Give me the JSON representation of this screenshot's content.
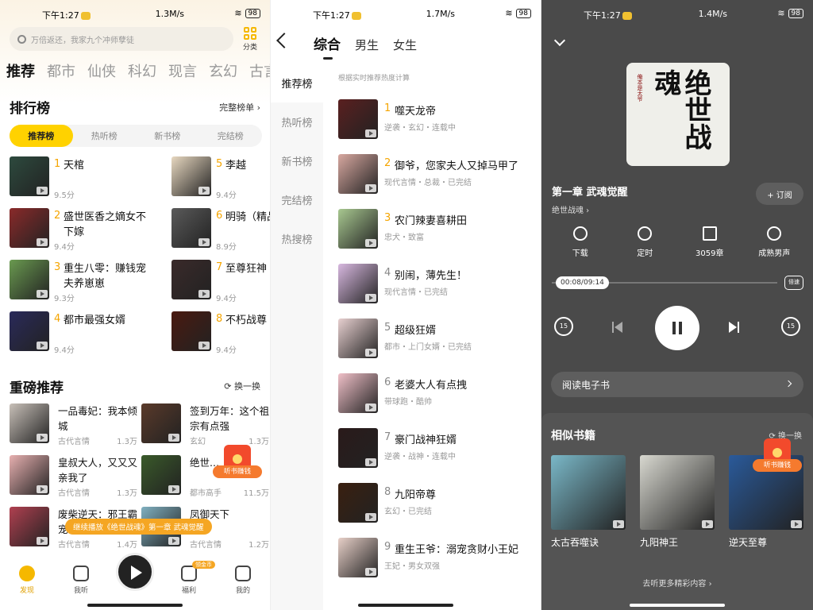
{
  "status": {
    "s1": {
      "time": "下午1:27",
      "speed": "1.3M/s",
      "battery": "98"
    },
    "s2": {
      "time": "下午1:27",
      "speed": "1.7M/s",
      "battery": "98"
    },
    "s3": {
      "time": "下午1:27",
      "speed": "1.4M/s",
      "battery": "98"
    }
  },
  "home": {
    "search_placeholder": "万倍返还，我家九个冲师孽徒",
    "category_label": "分类",
    "tabs": [
      "推荐",
      "都市",
      "仙侠",
      "科幻",
      "现言",
      "玄幻",
      "古言"
    ],
    "rank_title": "排行榜",
    "rank_more": "完整榜单 ›",
    "rank_tabs": [
      "推荐榜",
      "热听榜",
      "新书榜",
      "完结榜"
    ],
    "ranks": [
      {
        "rank": "1",
        "name": "天棺",
        "score": "9.5分",
        "color": "#2d4a3e"
      },
      {
        "rank": "2",
        "name": "盛世医香之嫡女不下嫁",
        "score": "9.4分",
        "color": "#8a2a2a"
      },
      {
        "rank": "3",
        "name": "重生八零：赚钱宠夫养崽崽",
        "score": "9.3分",
        "color": "#6a9a50"
      },
      {
        "rank": "4",
        "name": "都市最强女婿",
        "score": "9.4分",
        "color": "#2a2a5a"
      },
      {
        "rank": "5",
        "name": "李越",
        "score": "9.4分",
        "color": "#e8d8c0"
      },
      {
        "rank": "6",
        "name": "明骑（精品）",
        "score": "8.9分",
        "color": "#5a5a5a"
      },
      {
        "rank": "7",
        "name": "至尊狂神",
        "score": "9.4分",
        "color": "#3a2a2a"
      },
      {
        "rank": "8",
        "name": "不朽战尊",
        "score": "9.4分",
        "color": "#4a1a10"
      }
    ],
    "rec_title": "重磅推荐",
    "rec_more": "换一换",
    "recs": [
      {
        "name": "一品毒妃：我本倾城",
        "genre": "古代言情",
        "plays": "1.3万",
        "color": "#c8c0b8"
      },
      {
        "name": "皇叔大人，又又又亲我了",
        "genre": "古代言情",
        "plays": "1.3万",
        "color": "#e8b0b0"
      },
      {
        "name": "废柴逆天：邪王霸宠",
        "genre": "古代言情",
        "plays": "1.4万",
        "color": "#b04050"
      },
      {
        "name": "签到万年：这个祖宗有点强",
        "genre": "玄幻",
        "plays": "1.3万",
        "color": "#5a3a2a"
      },
      {
        "name": "绝世...",
        "genre": "都市高手",
        "plays": "11.5万",
        "color": "#3a5a2a"
      },
      {
        "name": "凤御天下",
        "genre": "古代言情",
        "plays": "1.2万",
        "color": "#80b0c0"
      }
    ],
    "toast": "继续播放《绝世战魂》第一章 武魂觉醒",
    "redpack_label": "听书赚钱",
    "nav": [
      {
        "label": "发现"
      },
      {
        "label": "我听"
      },
      {
        "label": ""
      },
      {
        "label": "福利",
        "badge": "领金币"
      },
      {
        "label": "我的"
      }
    ]
  },
  "ranking": {
    "tabs": [
      "综合",
      "男生",
      "女生"
    ],
    "side": [
      "推荐榜",
      "热听榜",
      "新书榜",
      "完结榜",
      "热搜榜"
    ],
    "hint": "根据实时推荐热度计算",
    "items": [
      {
        "rank": "1",
        "name": "噬天龙帝",
        "meta": "逆袭・玄幻・连载中",
        "color": "#5a2020"
      },
      {
        "rank": "2",
        "name": "御爷，您家夫人又掉马甲了",
        "meta": "现代言情・总裁・已完结",
        "color": "#d8a8a0"
      },
      {
        "rank": "3",
        "name": "农门辣妻喜耕田",
        "meta": "忠犬・致富",
        "color": "#a8c890"
      },
      {
        "rank": "4",
        "name": "别闹，薄先生！",
        "meta": "现代言情・已完结",
        "color": "#d8b8e0"
      },
      {
        "rank": "5",
        "name": "超级狂婿",
        "meta": "都市・上门女婿・已完结",
        "color": "#e8d0d0"
      },
      {
        "rank": "6",
        "name": "老婆大人有点拽",
        "meta": "带球跑・酷帅",
        "color": "#f0c0c8"
      },
      {
        "rank": "7",
        "name": "豪门战神狂婿",
        "meta": "逆袭・战神・连载中",
        "color": "#2a1a1a"
      },
      {
        "rank": "8",
        "name": "九阳帝尊",
        "meta": "玄幻・已完结",
        "color": "#3a2010"
      },
      {
        "rank": "9",
        "name": "重生王爷：溺宠贪财小王妃",
        "meta": "王妃・男女双强",
        "color": "#e8d0c8"
      }
    ]
  },
  "player": {
    "cover_title": "绝世战魂",
    "cover_sub": "俺本是太爷",
    "chapter": "第一章 武魂觉醒",
    "book": "绝世战魂 ›",
    "subscribe": "+ 订阅",
    "actions": [
      "下载",
      "定时",
      "3059章",
      "成熟男声"
    ],
    "progress_text": "00:08/09:14",
    "progress": 0.015,
    "speed": "1.0x",
    "speed_label": "倍速",
    "skip_back": "15",
    "skip_fwd": "15",
    "ebook": "阅读电子书",
    "similar_title": "相似书籍",
    "similar_refresh": "换一换",
    "similar": [
      {
        "name": "太古吞噬诀",
        "color": "#7ab8c8"
      },
      {
        "name": "九阳神王",
        "color": "#d8d8d0"
      },
      {
        "name": "逆天至尊",
        "color": "#2a5a9a"
      }
    ],
    "more": "去听更多精彩内容 ›",
    "redpack_label": "听书赚钱"
  }
}
